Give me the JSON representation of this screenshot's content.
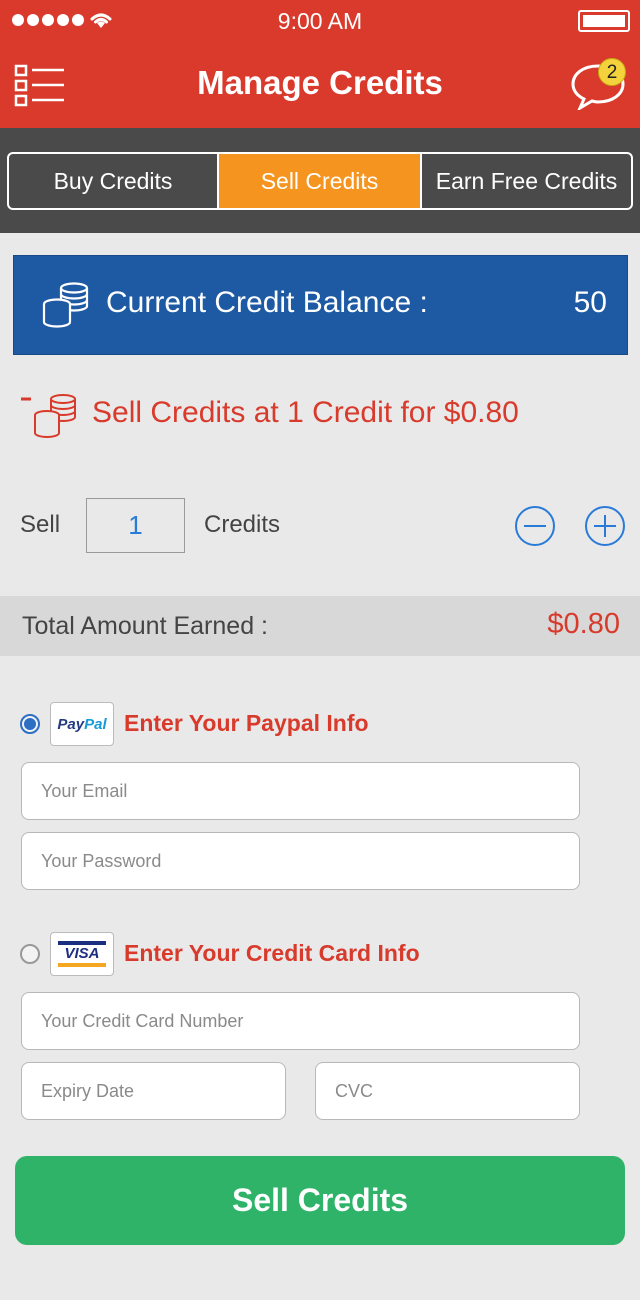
{
  "status_bar": {
    "time": "9:00 AM"
  },
  "header": {
    "title": "Manage Credits",
    "notification_count": "2"
  },
  "tabs": [
    {
      "label": "Buy Credits",
      "active": false
    },
    {
      "label": "Sell Credits",
      "active": true
    },
    {
      "label": "Earn Free Credits",
      "active": false
    }
  ],
  "balance": {
    "label": "Current Credit Balance :",
    "value": "50"
  },
  "rate": {
    "text": "Sell Credits at 1 Credit for $0.80"
  },
  "sell": {
    "prefix": "Sell",
    "quantity": "1",
    "suffix": "Credits"
  },
  "total": {
    "label": "Total Amount Earned :",
    "value": "$0.80"
  },
  "paypal": {
    "selected": true,
    "logo_text_a": "Pay",
    "logo_text_b": "Pal",
    "title": "Enter Your Paypal Info",
    "email_placeholder": "Your Email",
    "password_placeholder": "Your Password"
  },
  "card": {
    "selected": false,
    "logo_text": "VISA",
    "title": "Enter Your Credit Card Info",
    "number_placeholder": "Your Credit Card Number",
    "expiry_placeholder": "Expiry Date",
    "cvc_placeholder": "CVC"
  },
  "submit_label": "Sell Credits",
  "colors": {
    "header": "#d93a2b",
    "tab_active": "#f5941e",
    "balance_bg": "#1e5aa3",
    "accent_red": "#d83a2b",
    "submit": "#2fb368"
  }
}
